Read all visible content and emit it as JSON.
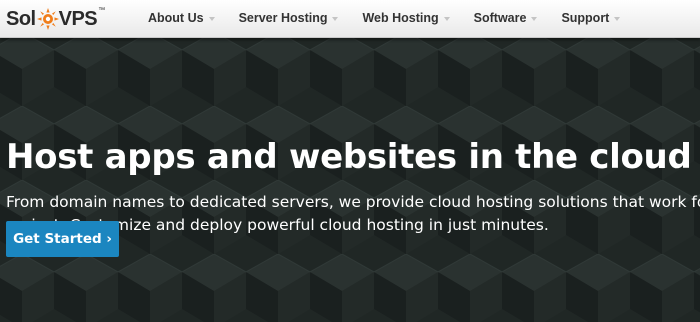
{
  "brand": {
    "logo_text_left": "Sol",
    "logo_text_right": "VPS",
    "logo_trademark": "™",
    "logo_icon": "sun-icon",
    "accent_color": "#f07d1a"
  },
  "nav": {
    "items": [
      {
        "label": "About Us"
      },
      {
        "label": "Server Hosting"
      },
      {
        "label": "Web Hosting"
      },
      {
        "label": "Software"
      },
      {
        "label": "Support"
      }
    ],
    "caret_icon": "chevron-down-icon"
  },
  "hero": {
    "title": "Host apps and websites in the cloud",
    "subtitle_line1": "From domain names to dedicated servers, we provide cloud hosting solutions that work for",
    "subtitle_line2": "project. Customize and deploy powerful cloud hosting in just minutes.",
    "cta_label": "Get Started ›",
    "cta_color": "#1b86c0",
    "background_color": "#202725"
  }
}
